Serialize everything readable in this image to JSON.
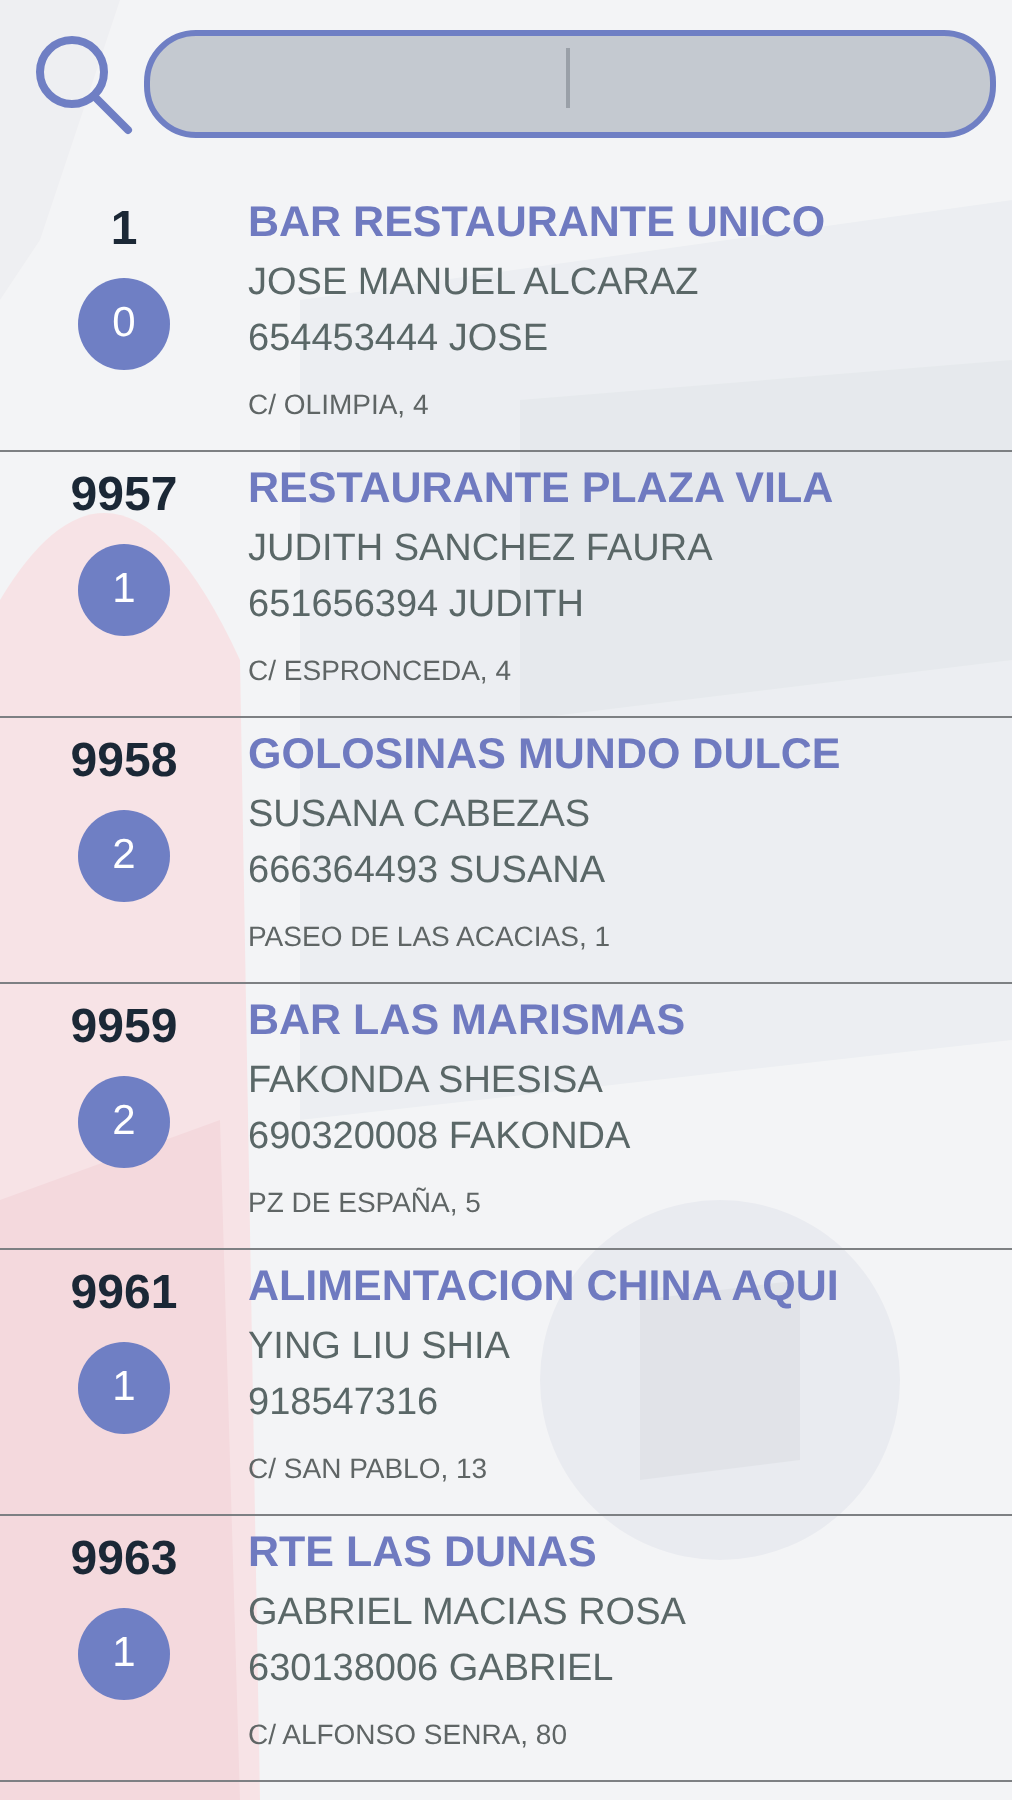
{
  "search": {
    "focused": true
  },
  "customers": [
    {
      "number": "1",
      "count": "0",
      "name": "BAR RESTAURANTE UNICO",
      "contact": "JOSE MANUEL ALCARAZ",
      "phone": "654453444 JOSE",
      "address": "C/ OLIMPIA, 4"
    },
    {
      "number": "9957",
      "count": "1",
      "name": "RESTAURANTE PLAZA VILA",
      "contact": "JUDITH SANCHEZ FAURA",
      "phone": "651656394 JUDITH",
      "address": "C/ ESPRONCEDA, 4"
    },
    {
      "number": "9958",
      "count": "2",
      "name": "GOLOSINAS MUNDO DULCE",
      "contact": "SUSANA CABEZAS",
      "phone": "666364493 SUSANA",
      "address": "PASEO DE LAS ACACIAS, 1"
    },
    {
      "number": "9959",
      "count": "2",
      "name": "BAR LAS MARISMAS",
      "contact": "FAKONDA SHESISA",
      "phone": "690320008 FAKONDA",
      "address": "PZ DE ESPAÑA, 5"
    },
    {
      "number": "9961",
      "count": "1",
      "name": "ALIMENTACION CHINA AQUI",
      "contact": "YING LIU SHIA",
      "phone": "918547316",
      "address": "C/ SAN PABLO, 13"
    },
    {
      "number": "9963",
      "count": "1",
      "name": "RTE LAS DUNAS",
      "contact": "GABRIEL MACIAS ROSA",
      "phone": "630138006  GABRIEL",
      "address": "C/ ALFONSO SENRA, 80"
    }
  ]
}
